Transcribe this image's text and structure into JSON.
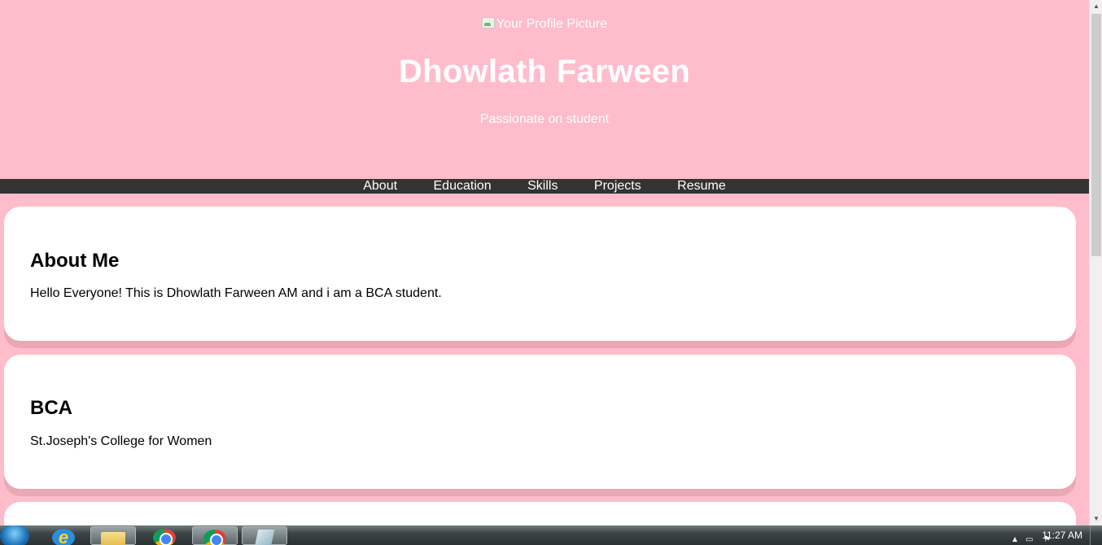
{
  "hero": {
    "profile_alt": "Your Profile Picture",
    "name": "Dhowlath Farween",
    "tagline": "Passionate on student"
  },
  "nav": {
    "items": [
      {
        "label": "About"
      },
      {
        "label": "Education"
      },
      {
        "label": "Skills"
      },
      {
        "label": "Projects"
      },
      {
        "label": "Resume"
      }
    ]
  },
  "sections": [
    {
      "heading": "About Me",
      "text": "Hello Everyone! This is Dhowlath Farween AM and i am a BCA student."
    },
    {
      "heading": "BCA",
      "text": "St.Joseph's College for Women"
    }
  ],
  "taskbar": {
    "clock": "11:27 AM",
    "apps": [
      {
        "icon": "internet-explorer-icon"
      },
      {
        "icon": "folder-icon"
      },
      {
        "icon": "chrome-icon"
      },
      {
        "icon": "chrome-icon"
      },
      {
        "icon": "paper-icon"
      }
    ]
  },
  "colors": {
    "page_background": "#ffbccb",
    "nav_background": "#333333",
    "card_background": "#ffffff",
    "card_shadow": "#e9a8b4",
    "header_text": "#ffffff"
  }
}
